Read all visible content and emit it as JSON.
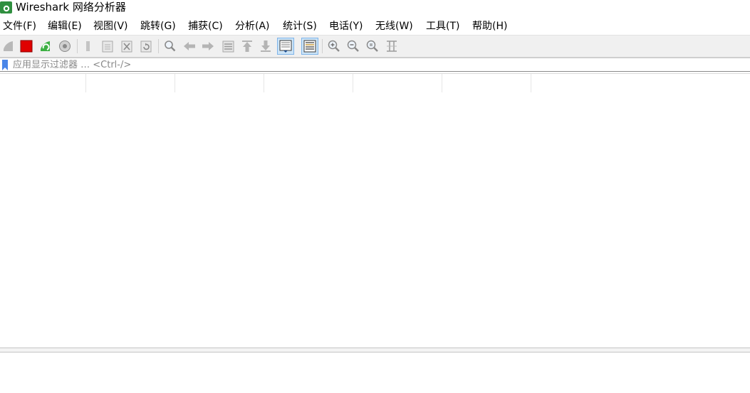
{
  "window": {
    "title": "Wireshark 网络分析器"
  },
  "menu": {
    "items": [
      "文件(F)",
      "编辑(E)",
      "视图(V)",
      "跳转(G)",
      "捕获(C)",
      "分析(A)",
      "统计(S)",
      "电话(Y)",
      "无线(W)",
      "工具(T)",
      "帮助(H)"
    ]
  },
  "toolbar": {
    "icons": [
      "start-capture-icon",
      "stop-capture-icon",
      "restart-capture-icon",
      "capture-options-icon",
      "open-file-icon",
      "save-file-icon",
      "close-file-icon",
      "reload-file-icon",
      "find-packet-icon",
      "go-back-icon",
      "go-forward-icon",
      "go-to-packet-icon",
      "go-first-packet-icon",
      "go-last-packet-icon",
      "auto-scroll-icon",
      "colorize-icon",
      "zoom-in-icon",
      "zoom-out-icon",
      "normal-size-icon",
      "resize-columns-icon"
    ],
    "active": [
      "auto-scroll-icon",
      "colorize-icon"
    ]
  },
  "filter": {
    "placeholder": "应用显示过滤器 … <Ctrl-/>",
    "value": ""
  },
  "colors": {
    "accent_active": "#cce4f7",
    "stop_red": "#e00000",
    "restart_green": "#3cb043",
    "bookmark_blue": "#4a86e8"
  }
}
